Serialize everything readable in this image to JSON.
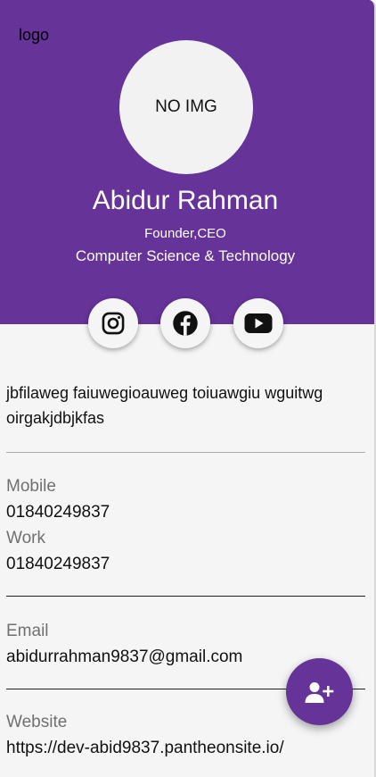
{
  "header": {
    "logo_text": "logo",
    "avatar_text": "NO IMG",
    "name": "Abidur Rahman",
    "role": "Founder,CEO",
    "department": "Computer Science & Technology",
    "bg_color": "#663399"
  },
  "social": [
    {
      "icon": "instagram-icon"
    },
    {
      "icon": "facebook-icon"
    },
    {
      "icon": "youtube-icon"
    }
  ],
  "bio": "jbfilaweg faiuwegioauweg toiuawgiu wguitwg oirgakjdbjkfas",
  "contacts": {
    "mobile_label": "Mobile",
    "mobile_value": "01840249837",
    "work_label": "Work",
    "work_value": "01840249837",
    "email_label": "Email",
    "email_value": "abidurrahman9837@gmail.com",
    "website_label": "Website",
    "website_value": "https://dev-abid9837.pantheonsite.io/"
  },
  "fab": {
    "icon": "add-contact-icon"
  }
}
